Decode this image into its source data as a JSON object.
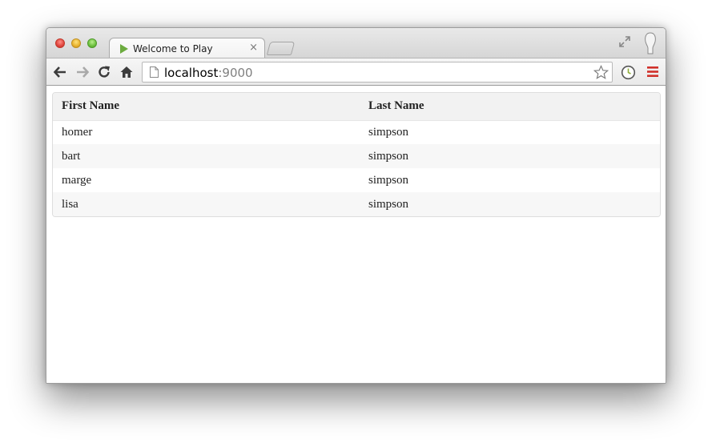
{
  "tab": {
    "title": "Welcome to Play",
    "close": "×"
  },
  "address": {
    "host": "localhost",
    "port": ":9000"
  },
  "table": {
    "headers": [
      "First Name",
      "Last Name"
    ],
    "rows": [
      [
        "homer",
        "simpson"
      ],
      [
        "bart",
        "simpson"
      ],
      [
        "marge",
        "simpson"
      ],
      [
        "lisa",
        "simpson"
      ]
    ]
  },
  "colors": {
    "play_green": "#6cab3f",
    "menu_red": "#d0302a"
  }
}
